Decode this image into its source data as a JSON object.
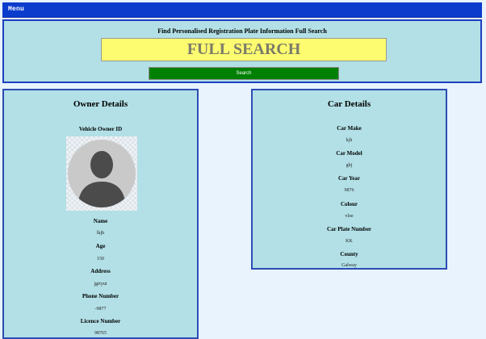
{
  "menu": {
    "label": "Menu"
  },
  "search": {
    "heading": "Find Personalised Registration Plate Information Full Search",
    "box_text": "FULL SEARCH",
    "button_label": "Search"
  },
  "owner": {
    "title": "Owner Details",
    "owner_id_label": "Vehicle Owner ID",
    "fields": [
      {
        "label": "Name",
        "value": "lkjh"
      },
      {
        "label": "Age",
        "value": "150"
      },
      {
        "label": "Address",
        "value": "jgrtyui"
      },
      {
        "label": "Phone Number",
        "value": "-9877"
      },
      {
        "label": "Licence Number",
        "value": "98765"
      }
    ]
  },
  "car": {
    "title": "Car Details",
    "fields": [
      {
        "label": "Car Make",
        "value": "kjh"
      },
      {
        "label": "Car Model",
        "value": "ghj"
      },
      {
        "label": "Car Year",
        "value": "9876"
      },
      {
        "label": "Colour",
        "value": "vloe"
      },
      {
        "label": "Car Plate Number",
        "value": "KK"
      },
      {
        "label": "County",
        "value": "Galway"
      }
    ]
  },
  "colors": {
    "menu_bg": "#0b3ccc",
    "panel_bg": "#b2e0e6",
    "page_bg": "#e8f3fe",
    "search_box_bg": "#fdfc70",
    "search_button_bg": "#008000",
    "border": "#1c3fbf"
  }
}
